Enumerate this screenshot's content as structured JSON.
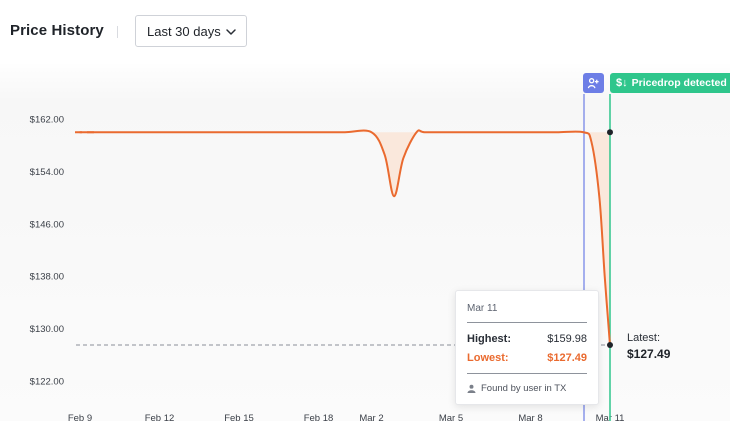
{
  "header": {
    "title": "Price History",
    "range_selected": "Last 30 days"
  },
  "markers": {
    "user_marker_icon": "user-plus-icon",
    "pricedrop_label": "Pricedrop detected",
    "pricedrop_symbol": "$↓",
    "colors": {
      "user_marker": "#6d7ee6",
      "pricedrop": "#2fc68c"
    }
  },
  "tooltip": {
    "date": "Mar 11",
    "highest_label": "Highest:",
    "highest_value": "$159.98",
    "lowest_label": "Lowest:",
    "lowest_value": "$127.49",
    "found_by": "Found by user in TX"
  },
  "latest": {
    "label": "Latest:",
    "value": "$127.49"
  },
  "chart_data": {
    "type": "line",
    "title": "",
    "xlabel": "",
    "ylabel": "",
    "ylim": [
      118,
      164
    ],
    "yticks": [
      "$162.00",
      "$154.00",
      "$146.00",
      "$138.00",
      "$130.00",
      "$122.00"
    ],
    "ytick_values": [
      162,
      154,
      146,
      138,
      130,
      122
    ],
    "xticks": [
      "Feb 9",
      "Feb 12",
      "Feb 15",
      "Feb 18",
      "Mar 2",
      "Mar 5",
      "Mar 8",
      "Mar 11"
    ],
    "xtick_values": [
      0,
      3,
      6,
      9,
      11,
      14,
      17,
      20
    ],
    "series": [
      {
        "color": "#ea6a2f",
        "x": [
          0,
          1,
          2,
          3,
          4,
          5,
          6,
          7,
          8,
          9,
          10,
          11,
          11.5,
          11.85,
          12.2,
          12.7,
          13,
          14,
          15,
          16,
          17,
          18,
          19,
          19.3,
          19.6,
          19.8,
          20
        ],
        "y": [
          159.98,
          159.98,
          159.98,
          159.98,
          159.98,
          159.98,
          159.98,
          159.98,
          159.98,
          159.98,
          159.98,
          159.98,
          156.5,
          150.2,
          156.0,
          159.98,
          159.98,
          159.98,
          159.98,
          159.98,
          159.98,
          159.98,
          159.98,
          158.5,
          150.0,
          138.0,
          127.49
        ]
      }
    ],
    "reference_line": {
      "value": 127.49,
      "style": "dashed"
    },
    "markers_x": {
      "user": 19,
      "pricedrop": 20
    },
    "grid": false,
    "colors": {
      "line": "#ea6a2f",
      "fill": "#fbe3d3"
    }
  }
}
